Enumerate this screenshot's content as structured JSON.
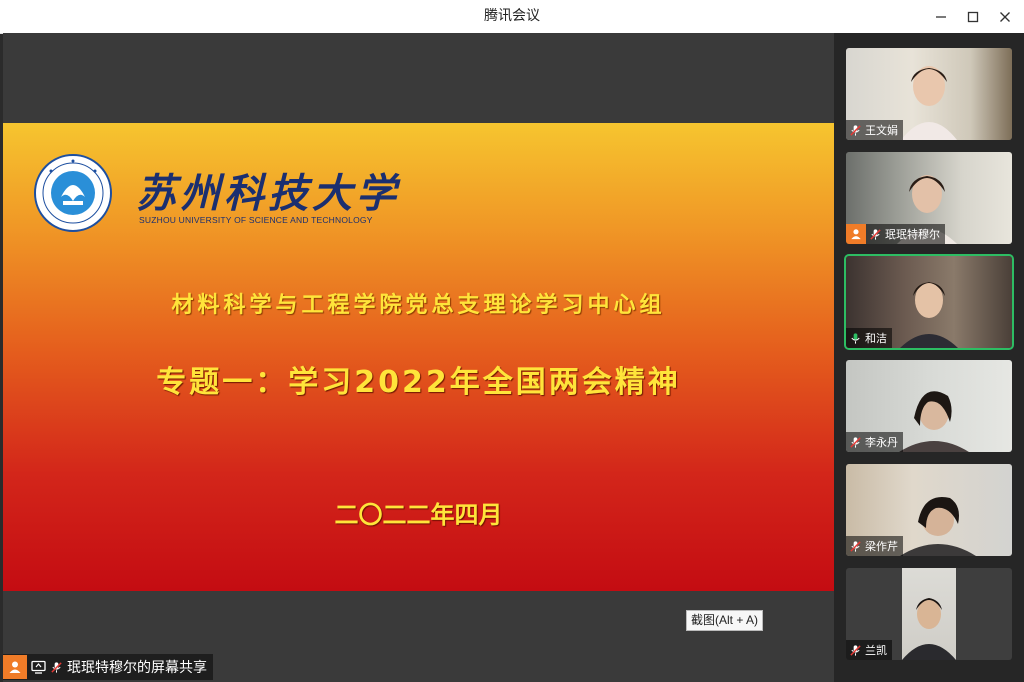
{
  "window": {
    "title": "腾讯会议"
  },
  "slide": {
    "logo_cn": "苏州科技大学",
    "logo_en": "SUZHOU UNIVERSITY OF SCIENCE AND TECHNOLOGY",
    "dept_title": "材料科学与工程学院党总支理论学习中心组",
    "topic_title": "专题一：学习2022年全国两会精神",
    "date_title": "二〇二二年四月"
  },
  "tooltip": {
    "screenshot": "截图(Alt + A)"
  },
  "share_banner": {
    "label": "珉珉特穆尔的屏幕共享"
  },
  "participants": [
    {
      "name": "王文娟",
      "mic": "muted",
      "host": false,
      "speaking": false
    },
    {
      "name": "珉珉特穆尔",
      "mic": "muted",
      "host": true,
      "speaking": false
    },
    {
      "name": "和洁",
      "mic": "active",
      "host": false,
      "speaking": true
    },
    {
      "name": "李永丹",
      "mic": "muted",
      "host": false,
      "speaking": false
    },
    {
      "name": "梁作芹",
      "mic": "muted",
      "host": false,
      "speaking": false
    },
    {
      "name": "兰凯",
      "mic": "muted",
      "host": false,
      "speaking": false
    }
  ],
  "colors": {
    "accent_host": "#f07c28",
    "speaking": "#2dbd63",
    "slide_text": "#ffe43a",
    "logo_blue": "#1b2f70"
  }
}
